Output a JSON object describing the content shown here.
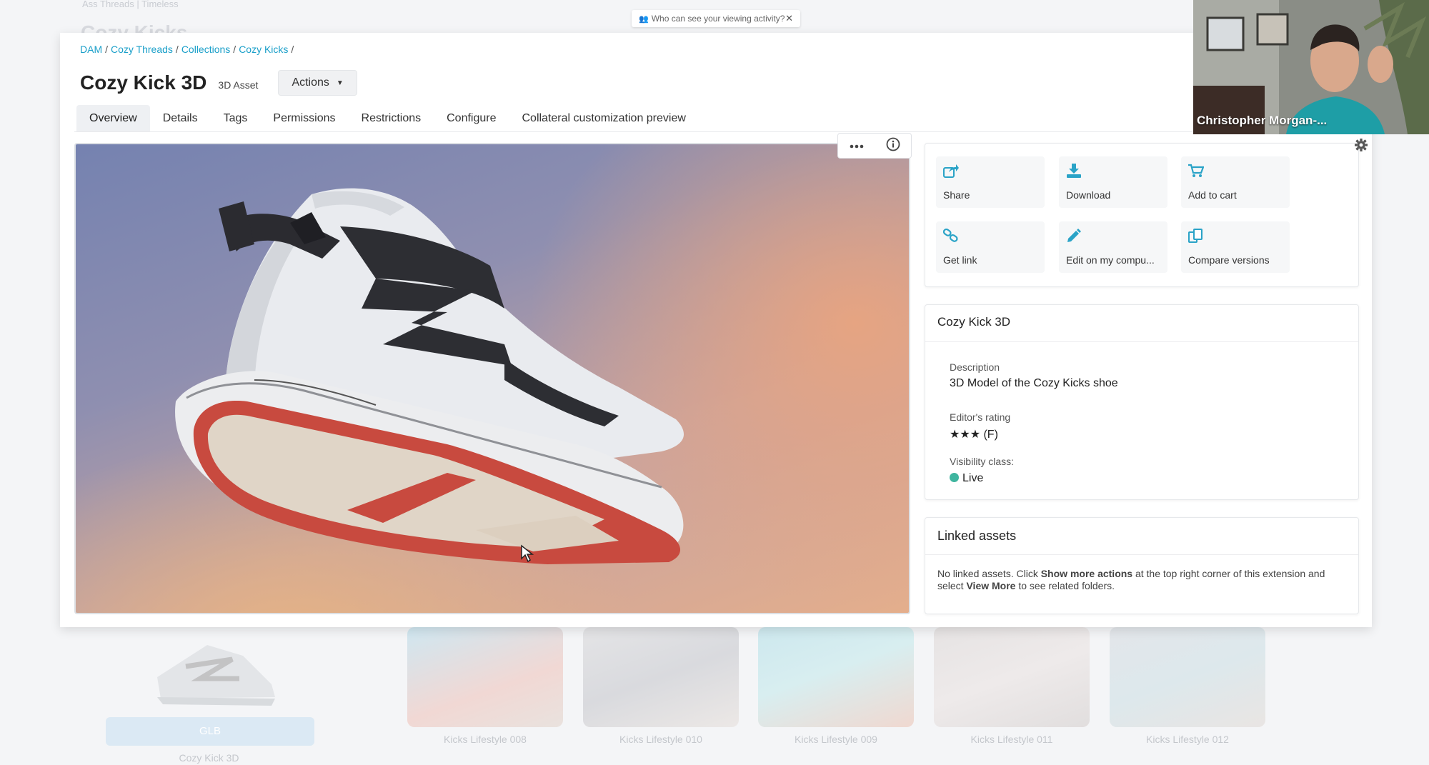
{
  "background": {
    "breadcrumb": "Ass Threads | Timeless",
    "title": "Cozy Kicks",
    "main_thumb_badge": "GLB",
    "main_thumb_caption": "Cozy Kick 3D",
    "thumbnails": [
      "Kicks Lifestyle 008",
      "Kicks Lifestyle 010",
      "Kicks Lifestyle 009",
      "Kicks Lifestyle 011",
      "Kicks Lifestyle 012"
    ]
  },
  "notice": {
    "text": "Who can see your viewing activity?",
    "close": "✕"
  },
  "video": {
    "participant_name": "Christopher Morgan-..."
  },
  "breadcrumb": {
    "items": [
      "DAM",
      "Cozy Threads",
      "Collections",
      "Cozy Kicks"
    ],
    "separator": "/"
  },
  "header": {
    "title": "Cozy Kick 3D",
    "asset_type": "3D Asset",
    "actions_label": "Actions"
  },
  "tabs": [
    "Overview",
    "Details",
    "Tags",
    "Permissions",
    "Restrictions",
    "Configure",
    "Collateral customization preview"
  ],
  "active_tab": "Overview",
  "viewer": {
    "top_icons": [
      "more-icon",
      "info-icon"
    ],
    "controls": [
      "reset-rotation-icon",
      "settings-icon",
      "fullscreen-icon"
    ]
  },
  "quick_actions": [
    {
      "label": "Share",
      "icon": "share-icon"
    },
    {
      "label": "Download",
      "icon": "download-icon"
    },
    {
      "label": "Add to cart",
      "icon": "cart-icon"
    },
    {
      "label": "Get link",
      "icon": "link-icon"
    },
    {
      "label": "Edit on my compu...",
      "icon": "pencil-icon"
    },
    {
      "label": "Compare versions",
      "icon": "compare-icon"
    }
  ],
  "info": {
    "title": "Cozy Kick 3D",
    "description_label": "Description",
    "description_value": "3D Model of the Cozy Kicks shoe",
    "rating_label": "Editor's rating",
    "rating_value": "★★★ (F)",
    "visibility_label": "Visibility class:",
    "visibility_value": "Live",
    "visibility_color": "#3fb59f"
  },
  "linked": {
    "title": "Linked assets",
    "text_1": "No linked assets. Click ",
    "bold_1": "Show more actions",
    "text_2": " at the top right corner of this extension and select ",
    "bold_2": "View More",
    "text_3": " to see related folders."
  },
  "colors": {
    "accent": "#1a9fc9",
    "icon_accent": "#2aa3c7",
    "live_dot": "#3fb59f"
  }
}
